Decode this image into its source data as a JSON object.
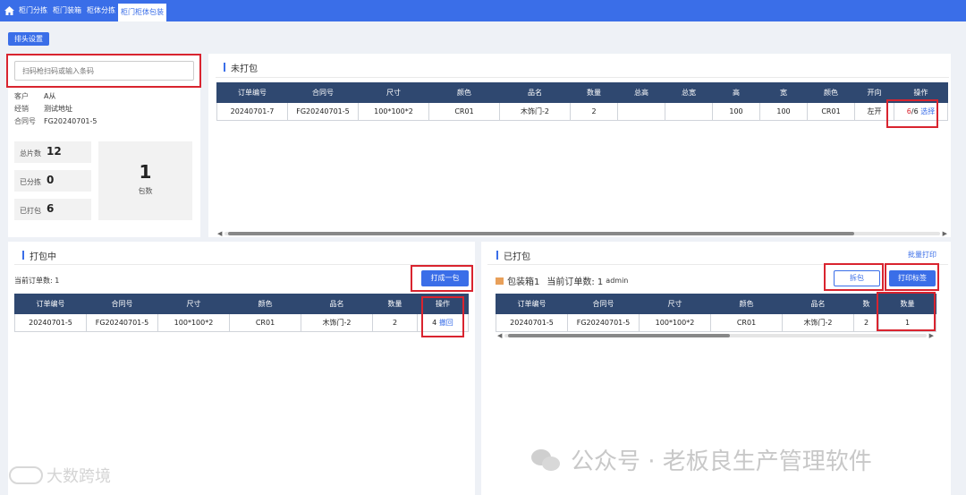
{
  "tabs": [
    {
      "label": "柜门分拣"
    },
    {
      "label": "柜门装箱"
    },
    {
      "label": "柜体分拣"
    },
    {
      "label": "柜门柜体包装"
    }
  ],
  "toolbar": {
    "settings_label": "排头设置"
  },
  "scan": {
    "placeholder": "扫码枪扫码或输入条码"
  },
  "info": {
    "customer_label": "客户",
    "customer_value": "A从",
    "dealer_label": "经销",
    "dealer_value": "测试地址",
    "contract_label": "合同号",
    "contract_value": "FG20240701-5"
  },
  "stats": {
    "total_label": "总片数",
    "total_value": "12",
    "sorted_label": "已分拣",
    "sorted_value": "0",
    "packed_label": "已打包",
    "packed_value": "6",
    "package_count": "1",
    "package_label": "包数"
  },
  "unpacked": {
    "title": "未打包",
    "headers": [
      "订单编号",
      "合同号",
      "尺寸",
      "颜色",
      "品名",
      "数量",
      "总高",
      "总宽",
      "高",
      "宽",
      "颜色",
      "开向",
      "操作"
    ],
    "row": {
      "order": "20240701-7",
      "contract": "FG20240701-5",
      "size": "100*100*2",
      "color": "CR01",
      "name": "木饰门-2",
      "qty": "2",
      "total_h": "",
      "total_w": "",
      "h": "100",
      "w": "100",
      "color2": "CR01",
      "direction": "左开",
      "op_num": "6",
      "op_total": "/6",
      "op_link": "选择"
    }
  },
  "packing": {
    "title": "打包中",
    "current_orders": "当前订单数: 1",
    "pack_button": "打成一包",
    "headers": [
      "订单编号",
      "合同号",
      "尺寸",
      "颜色",
      "品名",
      "数量",
      "操作"
    ],
    "row": {
      "order": "20240701-5",
      "contract": "FG20240701-5",
      "size": "100*100*2",
      "color": "CR01",
      "name": "木饰门-2",
      "qty": "2",
      "op_num": "4",
      "op_link": "撤回"
    }
  },
  "packed": {
    "title": "已打包",
    "batch_print": "批量打印",
    "box_name": "包装箱1",
    "current_orders": "当前订单数: 1",
    "user": "admin",
    "unpack_button": "拆包",
    "print_button": "打印标签",
    "headers": [
      "订单编号",
      "合同号",
      "尺寸",
      "颜色",
      "品名",
      "数",
      "数量"
    ],
    "row": {
      "order": "20240701-5",
      "contract": "FG20240701-5",
      "size": "100*100*2",
      "color": "CR01",
      "name": "木饰门-2",
      "qty_partial": "2",
      "qty": "1"
    }
  },
  "watermarks": {
    "brand": "公众号 · 老板良生产管理软件",
    "left": "大数跨境"
  },
  "colors": {
    "primary": "#3a6ee8",
    "header": "#2f4870",
    "highlight": "#d9242f"
  }
}
